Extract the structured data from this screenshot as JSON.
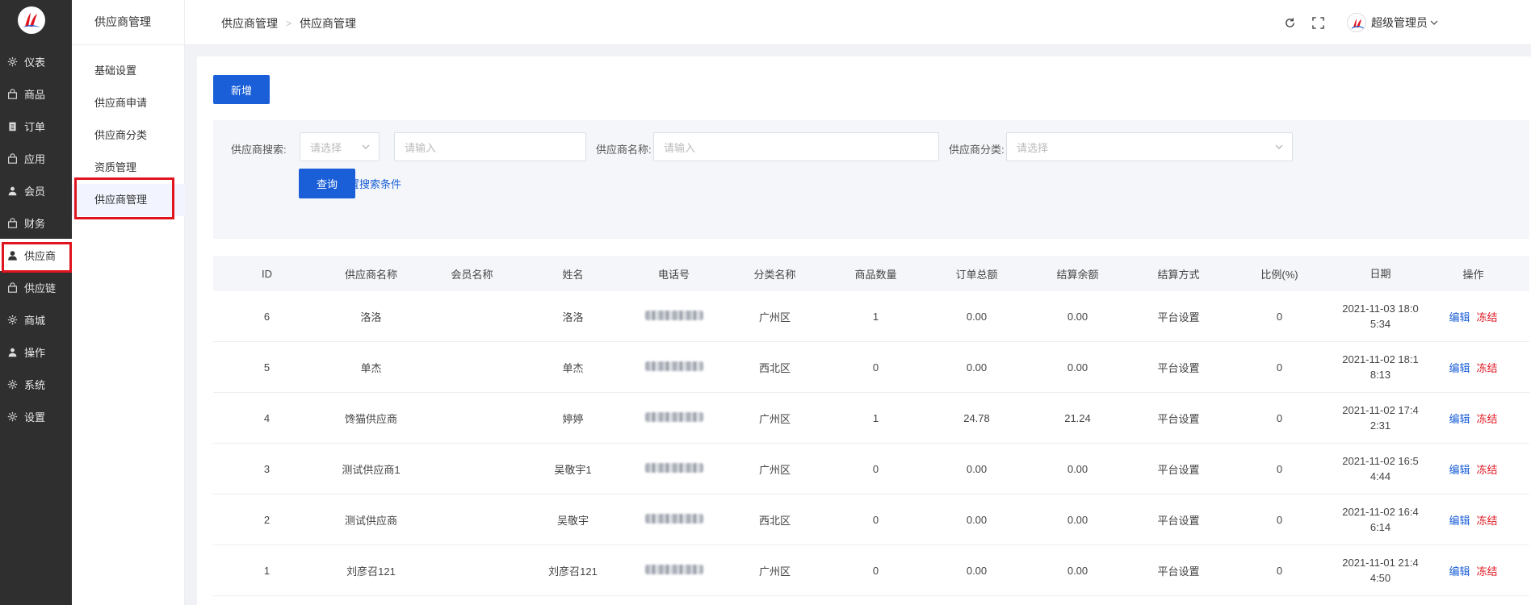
{
  "sidebar": {
    "items": [
      {
        "label": "仪表",
        "icon": "gear-icon"
      },
      {
        "label": "商品",
        "icon": "bag-icon"
      },
      {
        "label": "订单",
        "icon": "clipboard-icon"
      },
      {
        "label": "应用",
        "icon": "bag-icon"
      },
      {
        "label": "会员",
        "icon": "user-icon"
      },
      {
        "label": "财务",
        "icon": "bag-icon"
      },
      {
        "label": "供应商",
        "icon": "user-icon",
        "active": true
      },
      {
        "label": "供应链",
        "icon": "bag-icon"
      },
      {
        "label": "商城",
        "icon": "gear-icon"
      },
      {
        "label": "操作",
        "icon": "user-icon"
      },
      {
        "label": "系统",
        "icon": "gear-icon"
      },
      {
        "label": "设置",
        "icon": "gear-icon"
      }
    ]
  },
  "subnav": {
    "title": "供应商管理",
    "items": [
      {
        "label": "基础设置"
      },
      {
        "label": "供应商申请"
      },
      {
        "label": "供应商分类"
      },
      {
        "label": "资质管理"
      },
      {
        "label": "供应商管理",
        "active": true
      }
    ]
  },
  "header": {
    "breadcrumb": [
      "供应商管理",
      "供应商管理"
    ],
    "user_name": "超级管理员"
  },
  "main": {
    "add_label": "新增",
    "filters": {
      "search_label": "供应商搜索:",
      "search_select_placeholder": "请选择",
      "search_input_placeholder": "请输入",
      "name_label": "供应商名称:",
      "name_placeholder": "请输入",
      "category_label": "供应商分类:",
      "category_placeholder": "请选择",
      "query_label": "查询",
      "reset_label": "重置搜索条件"
    },
    "table": {
      "columns": [
        "ID",
        "供应商名称",
        "会员名称",
        "姓名",
        "电话号",
        "分类名称",
        "商品数量",
        "订单总额",
        "结算余额",
        "结算方式",
        "比例(%)",
        "日期",
        "操作"
      ],
      "rows": [
        {
          "id": "6",
          "name": "洛洛",
          "member": "",
          "real_name": "洛洛",
          "category": "广州区",
          "count": "1",
          "total": "0.00",
          "balance": "0.00",
          "mode": "平台设置",
          "ratio": "0",
          "date_1": "2021-11-03 18:0",
          "date_2": "5:34"
        },
        {
          "id": "5",
          "name": "单杰",
          "member": "",
          "real_name": "单杰",
          "category": "西北区",
          "count": "0",
          "total": "0.00",
          "balance": "0.00",
          "mode": "平台设置",
          "ratio": "0",
          "date_1": "2021-11-02 18:1",
          "date_2": "8:13"
        },
        {
          "id": "4",
          "name": "馋猫供应商",
          "member": "",
          "real_name": "婷婷",
          "category": "广州区",
          "count": "1",
          "total": "24.78",
          "balance": "21.24",
          "mode": "平台设置",
          "ratio": "0",
          "date_1": "2021-11-02 17:4",
          "date_2": "2:31"
        },
        {
          "id": "3",
          "name": "测试供应商1",
          "member": "",
          "real_name": "吴敬宇1",
          "category": "广州区",
          "count": "0",
          "total": "0.00",
          "balance": "0.00",
          "mode": "平台设置",
          "ratio": "0",
          "date_1": "2021-11-02 16:5",
          "date_2": "4:44"
        },
        {
          "id": "2",
          "name": "测试供应商",
          "member": "",
          "real_name": "吴敬宇",
          "category": "西北区",
          "count": "0",
          "total": "0.00",
          "balance": "0.00",
          "mode": "平台设置",
          "ratio": "0",
          "date_1": "2021-11-02 16:4",
          "date_2": "6:14"
        },
        {
          "id": "1",
          "name": "刘彦召121",
          "member": "",
          "real_name": "刘彦召121",
          "category": "广州区",
          "count": "0",
          "total": "0.00",
          "balance": "0.00",
          "mode": "平台设置",
          "ratio": "0",
          "date_1": "2021-11-01 21:4",
          "date_2": "4:50"
        }
      ],
      "edit_label": "编辑",
      "freeze_label": "冻结"
    }
  },
  "colors": {
    "primary": "#1a5fd8",
    "danger": "#e0141e",
    "sidebar_bg": "#2f2f2f",
    "highlight": "#e0141e"
  }
}
